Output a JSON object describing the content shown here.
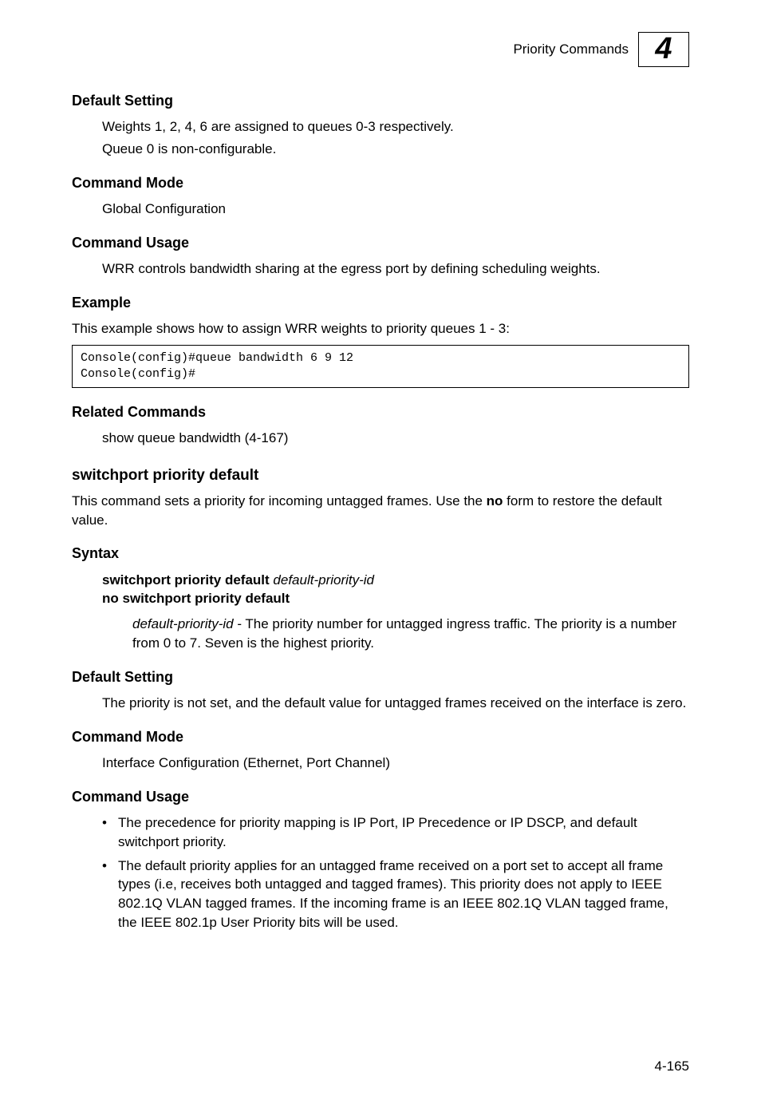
{
  "header": {
    "title": "Priority Commands",
    "chapter": "4"
  },
  "s1": {
    "head": "Default Setting",
    "line1": "Weights 1, 2, 4, 6 are assigned to queues 0-3 respectively.",
    "line2": "Queue 0 is non-configurable."
  },
  "s2": {
    "head": "Command Mode",
    "body": "Global Configuration"
  },
  "s3": {
    "head": "Command Usage",
    "body": "WRR controls bandwidth sharing at the egress port by defining scheduling weights."
  },
  "s4": {
    "head": "Example",
    "intro": "This example shows how to assign WRR weights to priority queues 1 - 3:",
    "code": "Console(config)#queue bandwidth 6 9 12\nConsole(config)#"
  },
  "s5": {
    "head": "Related Commands",
    "body": "show queue bandwidth (4-167)"
  },
  "cmd2": {
    "title": "switchport priority default",
    "intro_pre": "This command sets a priority for incoming untagged frames. Use the ",
    "intro_bold": "no",
    "intro_post": " form to restore the default value."
  },
  "syntax": {
    "head": "Syntax",
    "line1_bold": "switchport priority default ",
    "line1_italic": "default-priority-id",
    "line2_bold": "no switchport priority default",
    "desc_italic": "default-priority-id",
    "desc_rest": " - The priority number for untagged ingress traffic. The priority is a number from 0 to 7. Seven is the highest priority."
  },
  "s6": {
    "head": "Default Setting",
    "body": "The priority is not set, and the default value for untagged frames received on the interface is zero."
  },
  "s7": {
    "head": "Command Mode",
    "body": "Interface Configuration (Ethernet, Port Channel)"
  },
  "s8": {
    "head": "Command Usage",
    "bullet1": "The precedence for priority mapping is IP Port, IP Precedence or IP DSCP, and default switchport priority.",
    "bullet2": "The default priority applies for an untagged frame received on a port set to accept all frame types (i.e, receives both untagged and tagged frames). This priority does not apply to IEEE 802.1Q VLAN tagged frames. If the incoming frame is an IEEE 802.1Q VLAN tagged frame, the IEEE 802.1p User Priority bits will be used."
  },
  "page": "4-165"
}
